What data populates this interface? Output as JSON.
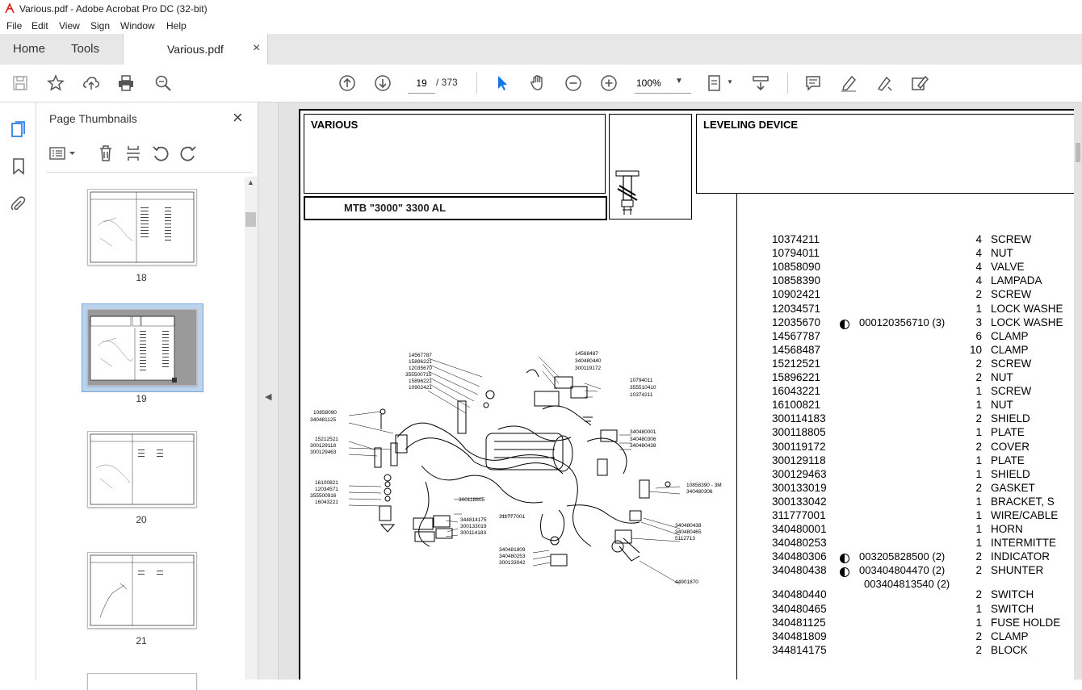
{
  "window": {
    "title": "Various.pdf - Adobe Acrobat Pro DC (32-bit)"
  },
  "menu": [
    "File",
    "Edit",
    "View",
    "Sign",
    "Window",
    "Help"
  ],
  "tabs": {
    "home": "Home",
    "tools": "Tools",
    "document": "Various.pdf",
    "close": "×"
  },
  "toolbar": {
    "page_current": "19",
    "page_total": "/ 373",
    "zoom": "100%"
  },
  "panel": {
    "title": "Page Thumbnails",
    "thumbnails": [
      {
        "label": "18"
      },
      {
        "label": "19"
      },
      {
        "label": "20"
      },
      {
        "label": "21"
      }
    ]
  },
  "doc": {
    "header_left": "VARIOUS",
    "header_right": "LEVELING DEVICE",
    "model": "MTB \"3000\" 3300 AL",
    "diagram_labels": [
      "14567787",
      "15896221",
      "12035670",
      "355500715",
      "15896221",
      "10902421",
      "14568487",
      "340480440",
      "300119172",
      "10794011",
      "355510410",
      "10374211",
      "10858090",
      "340481125",
      "15212521",
      "300129118",
      "300129463",
      "340480001",
      "340480306",
      "340480438",
      "10858390 - 3M",
      "340480306",
      "16100821",
      "12034571",
      "355500916",
      "16043221",
      "300118805",
      "344814175",
      "300133019",
      "300114183",
      "311777001",
      "340481809",
      "340480253",
      "300133042",
      "340480438",
      "340480465",
      "5112713",
      "44901870"
    ],
    "parts": [
      {
        "num": "10374211",
        "ext": "",
        "qty": "4",
        "desc": "SCREW"
      },
      {
        "num": "10794011",
        "ext": "",
        "qty": "4",
        "desc": "NUT"
      },
      {
        "num": "10858090",
        "ext": "",
        "qty": "4",
        "desc": "VALVE"
      },
      {
        "num": "10858390",
        "ext": "",
        "qty": "4",
        "desc": "LAMPADA"
      },
      {
        "num": "10902421",
        "ext": "",
        "qty": "2",
        "desc": "SCREW"
      },
      {
        "num": "12034571",
        "ext": "",
        "qty": "1",
        "desc": "LOCK WASHE"
      },
      {
        "num": "12035670",
        "ext": "000120356710  (3)",
        "qty": "3",
        "desc": "LOCK WASHE"
      },
      {
        "num": "14567787",
        "ext": "",
        "qty": "6",
        "desc": "CLAMP"
      },
      {
        "num": "14568487",
        "ext": "",
        "qty": "10",
        "desc": "CLAMP"
      },
      {
        "num": "15212521",
        "ext": "",
        "qty": "2",
        "desc": "SCREW"
      },
      {
        "num": "15896221",
        "ext": "",
        "qty": "2",
        "desc": "NUT"
      },
      {
        "num": "16043221",
        "ext": "",
        "qty": "1",
        "desc": "SCREW"
      },
      {
        "num": "16100821",
        "ext": "",
        "qty": "1",
        "desc": "NUT"
      },
      {
        "num": "300114183",
        "ext": "",
        "qty": "2",
        "desc": "SHIELD"
      },
      {
        "num": "300118805",
        "ext": "",
        "qty": "1",
        "desc": "PLATE"
      },
      {
        "num": "300119172",
        "ext": "",
        "qty": "2",
        "desc": "COVER"
      },
      {
        "num": "300129118",
        "ext": "",
        "qty": "1",
        "desc": "PLATE"
      },
      {
        "num": "300129463",
        "ext": "",
        "qty": "1",
        "desc": "SHIELD"
      },
      {
        "num": "300133019",
        "ext": "",
        "qty": "2",
        "desc": "GASKET"
      },
      {
        "num": "300133042",
        "ext": "",
        "qty": "1",
        "desc": "BRACKET, S"
      },
      {
        "num": "311777001",
        "ext": "",
        "qty": "1",
        "desc": "WIRE/CABLE"
      },
      {
        "num": "340480001",
        "ext": "",
        "qty": "1",
        "desc": "HORN"
      },
      {
        "num": "340480253",
        "ext": "",
        "qty": "1",
        "desc": "INTERMITTE"
      },
      {
        "num": "340480306",
        "ext": "003205828500  (2)",
        "qty": "2",
        "desc": "INDICATOR"
      },
      {
        "num": "340480438",
        "ext": "003404804470  (2)",
        "ext2": "003404813540  (2)",
        "qty": "2",
        "desc": "SHUNTER"
      },
      {
        "num": "340480440",
        "ext": "",
        "qty": "2",
        "desc": "SWITCH"
      },
      {
        "num": "340480465",
        "ext": "",
        "qty": "1",
        "desc": "SWITCH"
      },
      {
        "num": "340481125",
        "ext": "",
        "qty": "1",
        "desc": "FUSE HOLDE"
      },
      {
        "num": "340481809",
        "ext": "",
        "qty": "2",
        "desc": "CLAMP"
      },
      {
        "num": "344814175",
        "ext": "",
        "qty": "2",
        "desc": "BLOCK"
      }
    ]
  },
  "colors": {
    "acrobat_red": "#d9261c",
    "toolbar_blue": "#1473e6",
    "thumb_selected_bg": "#bcd3ee"
  }
}
